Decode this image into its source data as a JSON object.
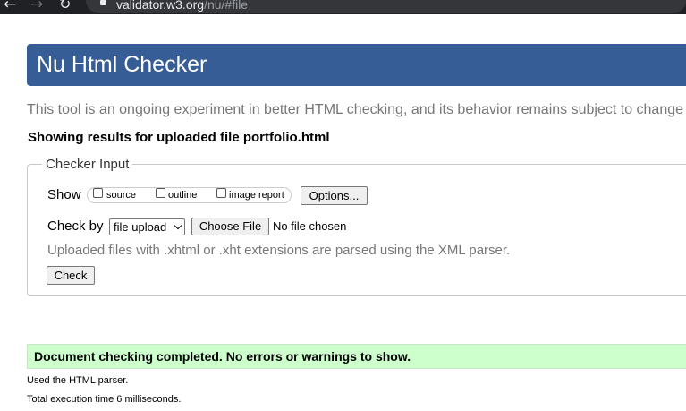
{
  "browser": {
    "url_host": "validator.w3.org",
    "url_path": "/nu/#file",
    "back_icon": "←",
    "forward_icon": "→",
    "reload_icon": "↻"
  },
  "header": {
    "title": "Nu Html Checker"
  },
  "intro": "This tool is an ongoing experiment in better HTML checking, and its behavior remains subject to change",
  "results_for": "Showing results for uploaded file portfolio.html",
  "checker_input": {
    "legend": "Checker Input",
    "show_label": "Show",
    "show_options": [
      {
        "label": "source",
        "checked": false
      },
      {
        "label": "outline",
        "checked": false
      },
      {
        "label": "image report",
        "checked": false
      }
    ],
    "options_button": "Options...",
    "check_by_label": "Check by",
    "check_by_value": "file upload",
    "choose_file_button": "Choose File",
    "no_file_text": "No file chosen",
    "xml_note": "Uploaded files with .xhtml or .xht extensions are parsed using the XML parser.",
    "check_button": "Check"
  },
  "result": {
    "success_message": "Document checking completed. No errors or warnings to show.",
    "parser_note": "Used the HTML parser.",
    "execution_time": "Total execution time 6 milliseconds."
  },
  "colors": {
    "header_bg": "#365d95",
    "success_bg": "#ccffcc",
    "muted_text": "#777777"
  }
}
